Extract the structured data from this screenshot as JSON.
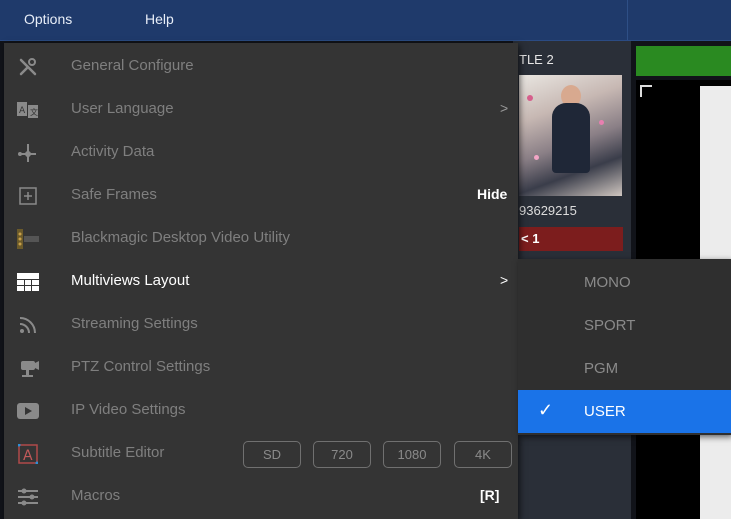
{
  "menubar": {
    "items": [
      "Options",
      "Help"
    ]
  },
  "background": {
    "panel_title": "TLE 2",
    "panel_number": "93629215",
    "panel_tag": "< 1"
  },
  "options_menu": {
    "items": [
      {
        "label": "General Configure",
        "icon": "wrench-screwdriver-icon"
      },
      {
        "label": "User Language",
        "icon": "language-icon",
        "arrow": ">"
      },
      {
        "label": "Activity Data",
        "icon": "activity-node-icon"
      },
      {
        "label": "Safe Frames",
        "icon": "plus-square-icon",
        "right": "Hide"
      },
      {
        "label": "Blackmagic Desktop Video Utility",
        "icon": "blackmagic-icon"
      },
      {
        "label": "Multiviews Layout",
        "icon": "grid-layout-icon",
        "arrow": ">"
      },
      {
        "label": "Streaming Settings",
        "icon": "rss-icon"
      },
      {
        "label": "PTZ Control Settings",
        "icon": "camera-icon"
      },
      {
        "label": "IP Video Settings",
        "icon": "play-icon"
      },
      {
        "label": "Subtitle Editor",
        "icon": "subtitle-a-icon",
        "buttons": [
          "SD",
          "720",
          "1080",
          "4K"
        ]
      },
      {
        "label": "Macros",
        "icon": "sliders-icon",
        "right": "[R]"
      }
    ]
  },
  "submenu": {
    "items": [
      "MONO",
      "SPORT",
      "PGM",
      "USER"
    ],
    "selected": "USER",
    "check": "✓"
  },
  "colors": {
    "menubar": "#1f3a6b",
    "menu_bg": "#343434",
    "selection": "#1a73e8",
    "green": "#2a8a21",
    "red": "#7c1d1d"
  }
}
